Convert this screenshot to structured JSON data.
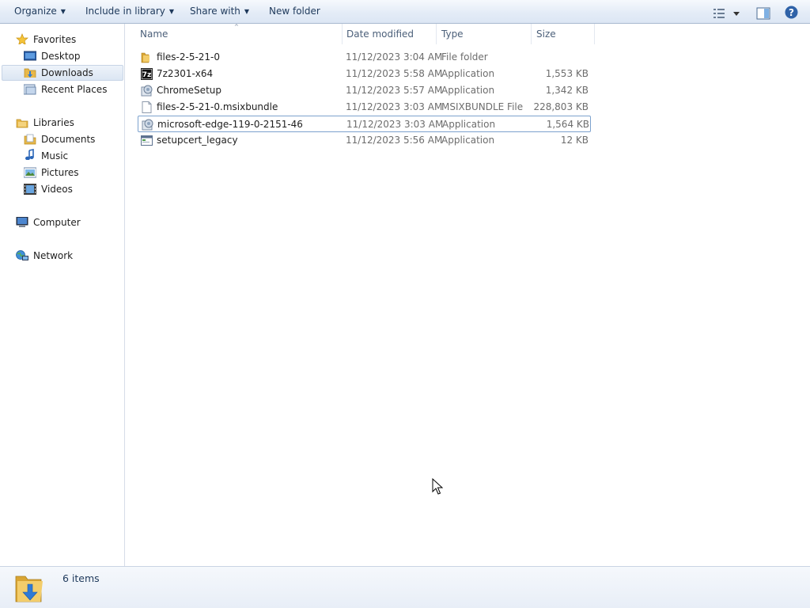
{
  "toolbar": {
    "organize": "Organize",
    "include_in_library": "Include in library",
    "share_with": "Share with",
    "new_folder": "New folder",
    "dropdown_arrow": "▼"
  },
  "nav": {
    "favorites": {
      "label": "Favorites",
      "icon": "star-icon"
    },
    "favorites_items": [
      {
        "label": "Desktop",
        "icon": "desktop-icon"
      },
      {
        "label": "Downloads",
        "icon": "downloads-folder-icon",
        "selected": true
      },
      {
        "label": "Recent Places",
        "icon": "recent-places-icon"
      }
    ],
    "libraries": {
      "label": "Libraries",
      "icon": "libraries-icon"
    },
    "libraries_items": [
      {
        "label": "Documents",
        "icon": "documents-icon"
      },
      {
        "label": "Music",
        "icon": "music-icon"
      },
      {
        "label": "Pictures",
        "icon": "pictures-icon"
      },
      {
        "label": "Videos",
        "icon": "videos-icon"
      }
    ],
    "computer": {
      "label": "Computer",
      "icon": "computer-icon"
    },
    "network": {
      "label": "Network",
      "icon": "network-icon"
    }
  },
  "columns": {
    "name": "Name",
    "date_modified": "Date modified",
    "type": "Type",
    "size": "Size",
    "sort_indicator": "^"
  },
  "files": [
    {
      "name": "files-2-5-21-0",
      "date": "11/12/2023 3:04 AM",
      "type": "File folder",
      "size": "",
      "icon": "folder-icon"
    },
    {
      "name": "7z2301-x64",
      "date": "11/12/2023 5:58 AM",
      "type": "Application",
      "size": "1,553 KB",
      "icon": "7zip-icon"
    },
    {
      "name": "ChromeSetup",
      "date": "11/12/2023 5:57 AM",
      "type": "Application",
      "size": "1,342 KB",
      "icon": "installer-icon"
    },
    {
      "name": "files-2-5-21-0.msixbundle",
      "date": "11/12/2023 3:03 AM",
      "type": "MSIXBUNDLE File",
      "size": "228,803 KB",
      "icon": "file-icon"
    },
    {
      "name": "microsoft-edge-119-0-2151-46",
      "date": "11/12/2023 3:03 AM",
      "type": "Application",
      "size": "1,564 KB",
      "icon": "installer-icon",
      "focused": true
    },
    {
      "name": "setupcert_legacy",
      "date": "11/12/2023 5:56 AM",
      "type": "Application",
      "size": "12 KB",
      "icon": "app-window-icon"
    }
  ],
  "details": {
    "count": "6 items",
    "icon": "downloads-folder-icon"
  },
  "colors": {
    "toolbar_text": "#1e395b",
    "selection_border": "#7da2ce",
    "folder_yellow": "#e8b84a"
  }
}
